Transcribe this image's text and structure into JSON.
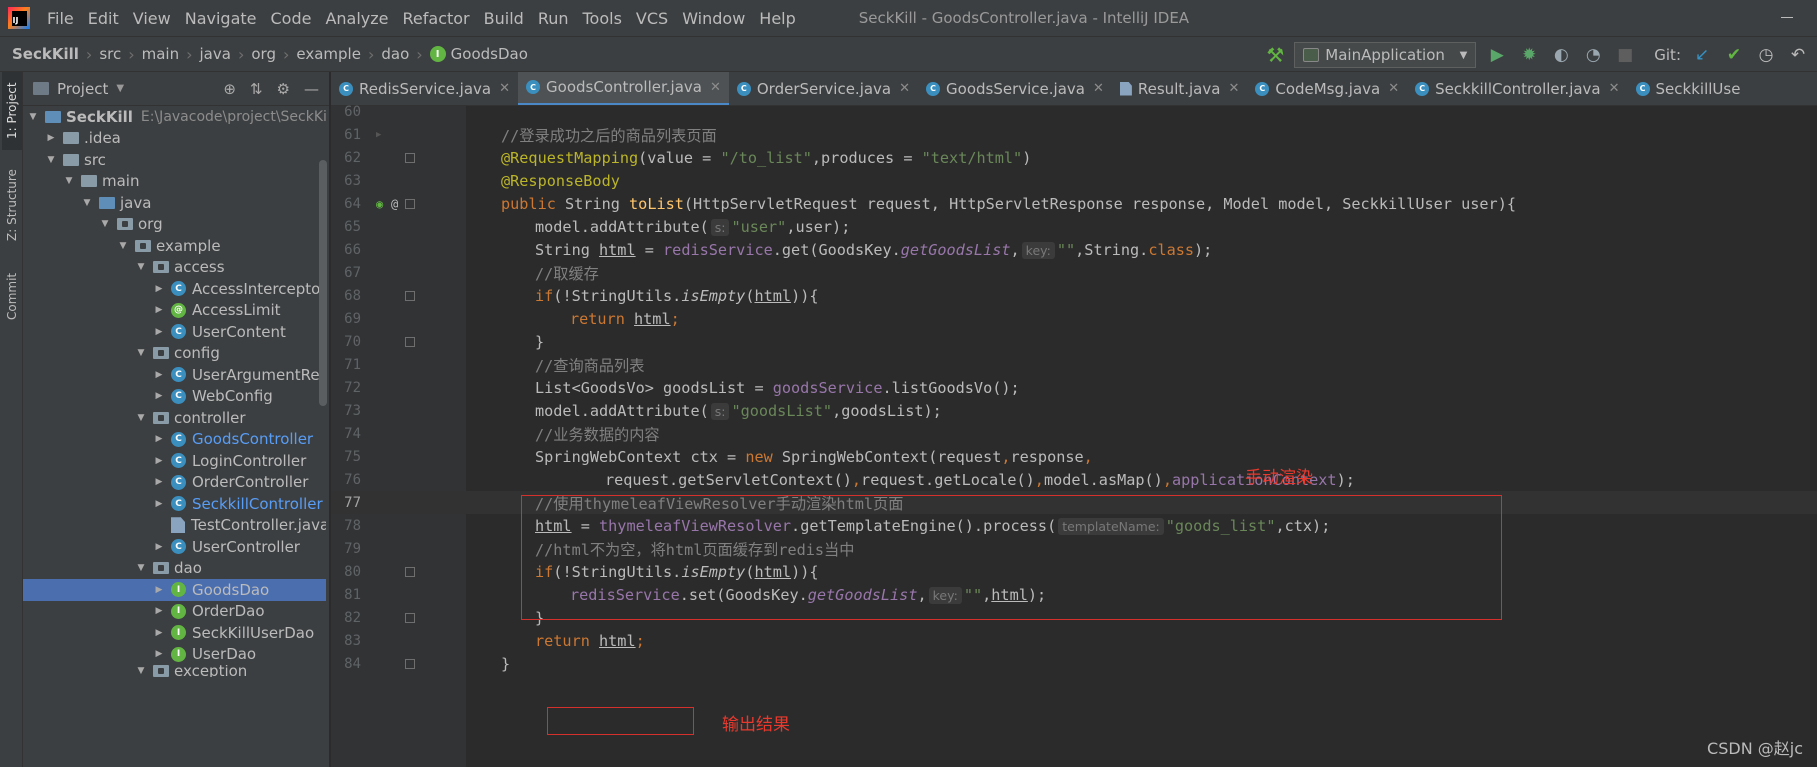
{
  "window": {
    "title": "SeckKill - GoodsController.java - IntelliJ IDEA",
    "logo_text": "IJ"
  },
  "menu": [
    "File",
    "Edit",
    "View",
    "Navigate",
    "Code",
    "Analyze",
    "Refactor",
    "Build",
    "Run",
    "Tools",
    "VCS",
    "Window",
    "Help"
  ],
  "breadcrumb": [
    "SeckKill",
    "src",
    "main",
    "java",
    "org",
    "example",
    "dao",
    "GoodsDao"
  ],
  "toolbar": {
    "run_config": "MainApplication",
    "git_label": "Git:"
  },
  "side_tabs": {
    "project": "1: Project",
    "structure": "Z: Structure",
    "commit": "Commit"
  },
  "project_pane": {
    "title": "Project"
  },
  "tree": [
    {
      "label": "SeckKill",
      "path": "E:\\Javacode\\project\\SeckKill"
    },
    {
      "label": ".idea"
    },
    {
      "label": "src"
    },
    {
      "label": "main"
    },
    {
      "label": "java"
    },
    {
      "label": "org"
    },
    {
      "label": "example"
    },
    {
      "label": "access"
    },
    {
      "label": "AccessInterceptor"
    },
    {
      "label": "AccessLimit"
    },
    {
      "label": "UserContent"
    },
    {
      "label": "config"
    },
    {
      "label": "UserArgumentResol"
    },
    {
      "label": "WebConfig"
    },
    {
      "label": "controller"
    },
    {
      "label": "GoodsController"
    },
    {
      "label": "LoginController"
    },
    {
      "label": "OrderController"
    },
    {
      "label": "SeckkillController"
    },
    {
      "label": "TestController.java"
    },
    {
      "label": "UserController"
    },
    {
      "label": "dao"
    },
    {
      "label": "GoodsDao"
    },
    {
      "label": "OrderDao"
    },
    {
      "label": "SeckKillUserDao"
    },
    {
      "label": "UserDao"
    },
    {
      "label": "exception"
    }
  ],
  "tabs": [
    "RedisService.java",
    "GoodsController.java",
    "OrderService.java",
    "GoodsService.java",
    "Result.java",
    "CodeMsg.java",
    "SeckkillController.java",
    "SeckkillUse"
  ],
  "code": {
    "lines": [
      "60",
      "61",
      "62",
      "63",
      "64",
      "65",
      "66",
      "67",
      "68",
      "69",
      "70",
      "71",
      "72",
      "73",
      "74",
      "75",
      "76",
      "77",
      "78",
      "79",
      "80",
      "81",
      "82",
      "83",
      "84"
    ],
    "t61": "//登录成功之后的商品列表页面",
    "t62a": "@RequestMapping",
    "t62b": "(value = ",
    "t62c": "\"/to_list\"",
    "t62d": ",produces = ",
    "t62e": "\"text/html\"",
    "t62f": ")",
    "t63": "@ResponseBody",
    "t64a": "public ",
    "t64b": "String ",
    "t64c": "toList",
    "t64d": "(HttpServletRequest request, HttpServletResponse response, Model model, SeckkillUser user){",
    "t65a": "model.addAttribute(",
    "h65": "s:",
    "t65b": "\"user\"",
    "t65c": ",user);",
    "t66a": "String ",
    "t66b": "html",
    " t66c": " = ",
    "t66d": "redisService",
    "t66e": ".get(GoodsKey.",
    "t66f": "getGoodsList",
    ",": ",",
    "h66": "key:",
    "t66g": "\"\"",
    "t66h": ",String.",
    "t66i": "class",
    "t66j": ");",
    "t67": "//取缓存",
    "t68a": "if",
    "t68b": "(!StringUtils.",
    "t68c": "isEmpty",
    "t68d": "(",
    "t68e": "html",
    "t68f": ")){",
    "t69a": "return ",
    "t69b": "html",
    "t69c": ";",
    "t70": "}",
    "t71": "//查询商品列表",
    "t72a": "List<GoodsVo> goodsList = ",
    "t72b": "goodsService",
    ".t72c": ".listGoodsVo();",
    "t73a": "model.addAttribute(",
    "h73": "s:",
    "t73b": "\"goodsList\"",
    "t73c": ",goodsList);",
    "t74": "//业务数据的内容",
    "t75a": "SpringWebContext ctx = ",
    "t75b": "new ",
    "t75c": "SpringWebContext(request",
    "t75d": "response",
    "t76a": "request.getServletContext()",
    "t76b": ",",
    "t76c": "request.getLocale()",
    "t76e": "model.asMap()",
    "t76f": "applicationContext",
    "t76g": ");",
    "t77": "//使用thymeleafViewResolver手动渲染html页面",
    "t78a": "html",
    "t78b": " = ",
    "t78c": "thymeleafViewResolver",
    "t78d": ".getTemplateEngine().process(",
    "h78": "templateName:",
    "t78e": "\"goods_list\"",
    "t78f": ",ctx);",
    "t79": "//html不为空，将html页面缓存到redis当中",
    "t80a": "if",
    "t80b": "(!StringUtils.",
    "t80c": "isEmpty",
    "t80d": "(",
    "t80e": "html",
    "t80f": ")){",
    "t81a": "redisService",
    "t81b": ".set(GoodsKey.",
    "t81c": "getGoodsList",
    "t81d": ",",
    "h81": "key:",
    "t81e": "\"\"",
    "t81f": ",",
    "t81g": "html",
    "t81h": ");",
    "t82": "}",
    "t83a": "return ",
    "t83b": "html",
    "t83c": ";",
    "t84": "}"
  },
  "annotations": {
    "manual_render": "手动渲染",
    "output_result": "输出结果"
  },
  "watermark": "CSDN @赵jc",
  "colors": {
    "accent": "#4a88c7",
    "selection": "#4b6eaf",
    "annotation_red": "#d6302c"
  }
}
